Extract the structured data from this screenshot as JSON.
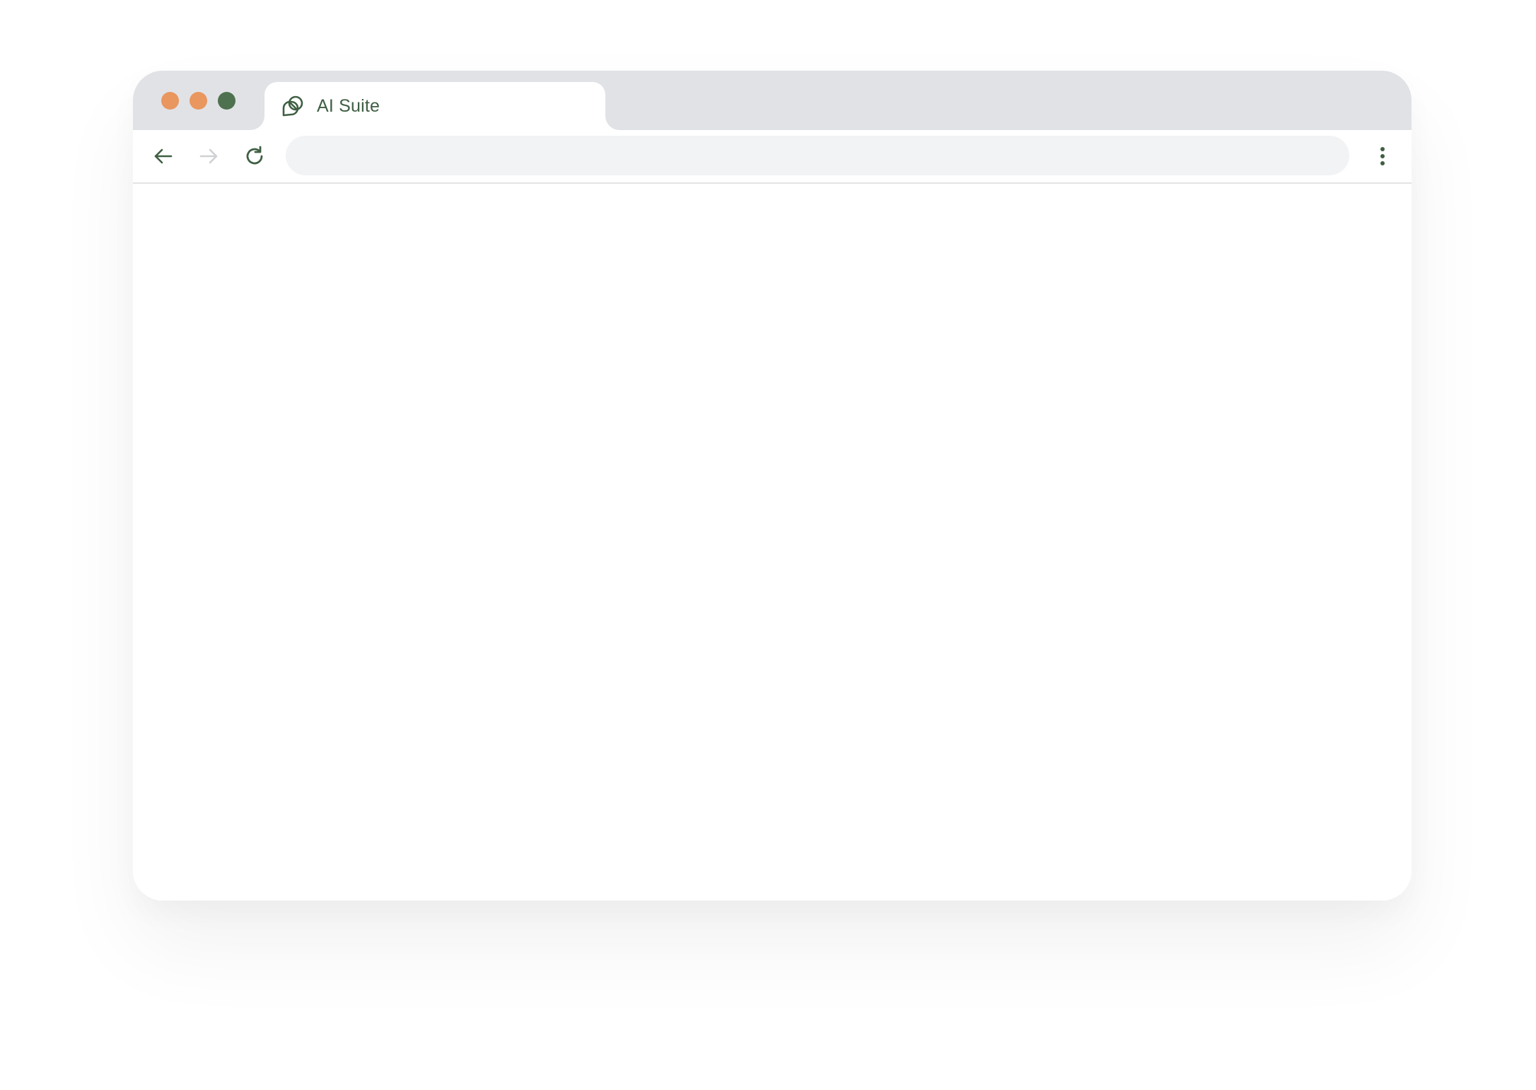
{
  "colors": {
    "titlebar_bg": "#e1e2e6",
    "traffic_close": "#e9965f",
    "traffic_minimize": "#e9965f",
    "traffic_maximize": "#4e7150",
    "brand_green": "#3f5f43",
    "disabled_icon": "#cfd1d4",
    "address_bg": "#f2f3f5"
  },
  "tab": {
    "title": "AI Suite",
    "icon": "ai-suite-logo-icon"
  },
  "toolbar": {
    "back_icon": "arrow-left-icon",
    "forward_icon": "arrow-right-icon",
    "forward_disabled": true,
    "reload_icon": "reload-icon",
    "menu_icon": "more-vertical-icon",
    "address": {
      "value": "",
      "placeholder": ""
    }
  }
}
